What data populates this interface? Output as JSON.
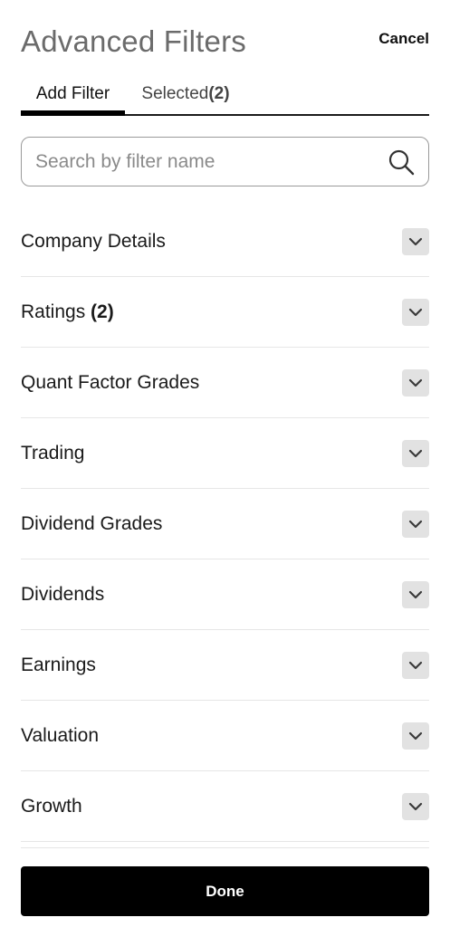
{
  "header": {
    "title": "Advanced Filters",
    "cancel_label": "Cancel"
  },
  "tabs": {
    "add_filter_label": "Add Filter",
    "selected_label": "Selected",
    "selected_count": "(2)"
  },
  "search": {
    "placeholder": "Search by filter name",
    "value": ""
  },
  "filters": [
    {
      "label": "Company Details",
      "count": ""
    },
    {
      "label": "Ratings",
      "count": "(2)"
    },
    {
      "label": "Quant Factor Grades",
      "count": ""
    },
    {
      "label": "Trading",
      "count": ""
    },
    {
      "label": "Dividend Grades",
      "count": ""
    },
    {
      "label": "Dividends",
      "count": ""
    },
    {
      "label": "Earnings",
      "count": ""
    },
    {
      "label": "Valuation",
      "count": ""
    },
    {
      "label": "Growth",
      "count": ""
    }
  ],
  "footer": {
    "done_label": "Done"
  },
  "icons": {
    "search": "search-icon",
    "chevron": "chevron-down-icon"
  },
  "colors": {
    "title": "#6b6b6b",
    "primary": "#000000",
    "chevron_bg": "#e2e2e2",
    "divider": "#e6e6e6"
  }
}
